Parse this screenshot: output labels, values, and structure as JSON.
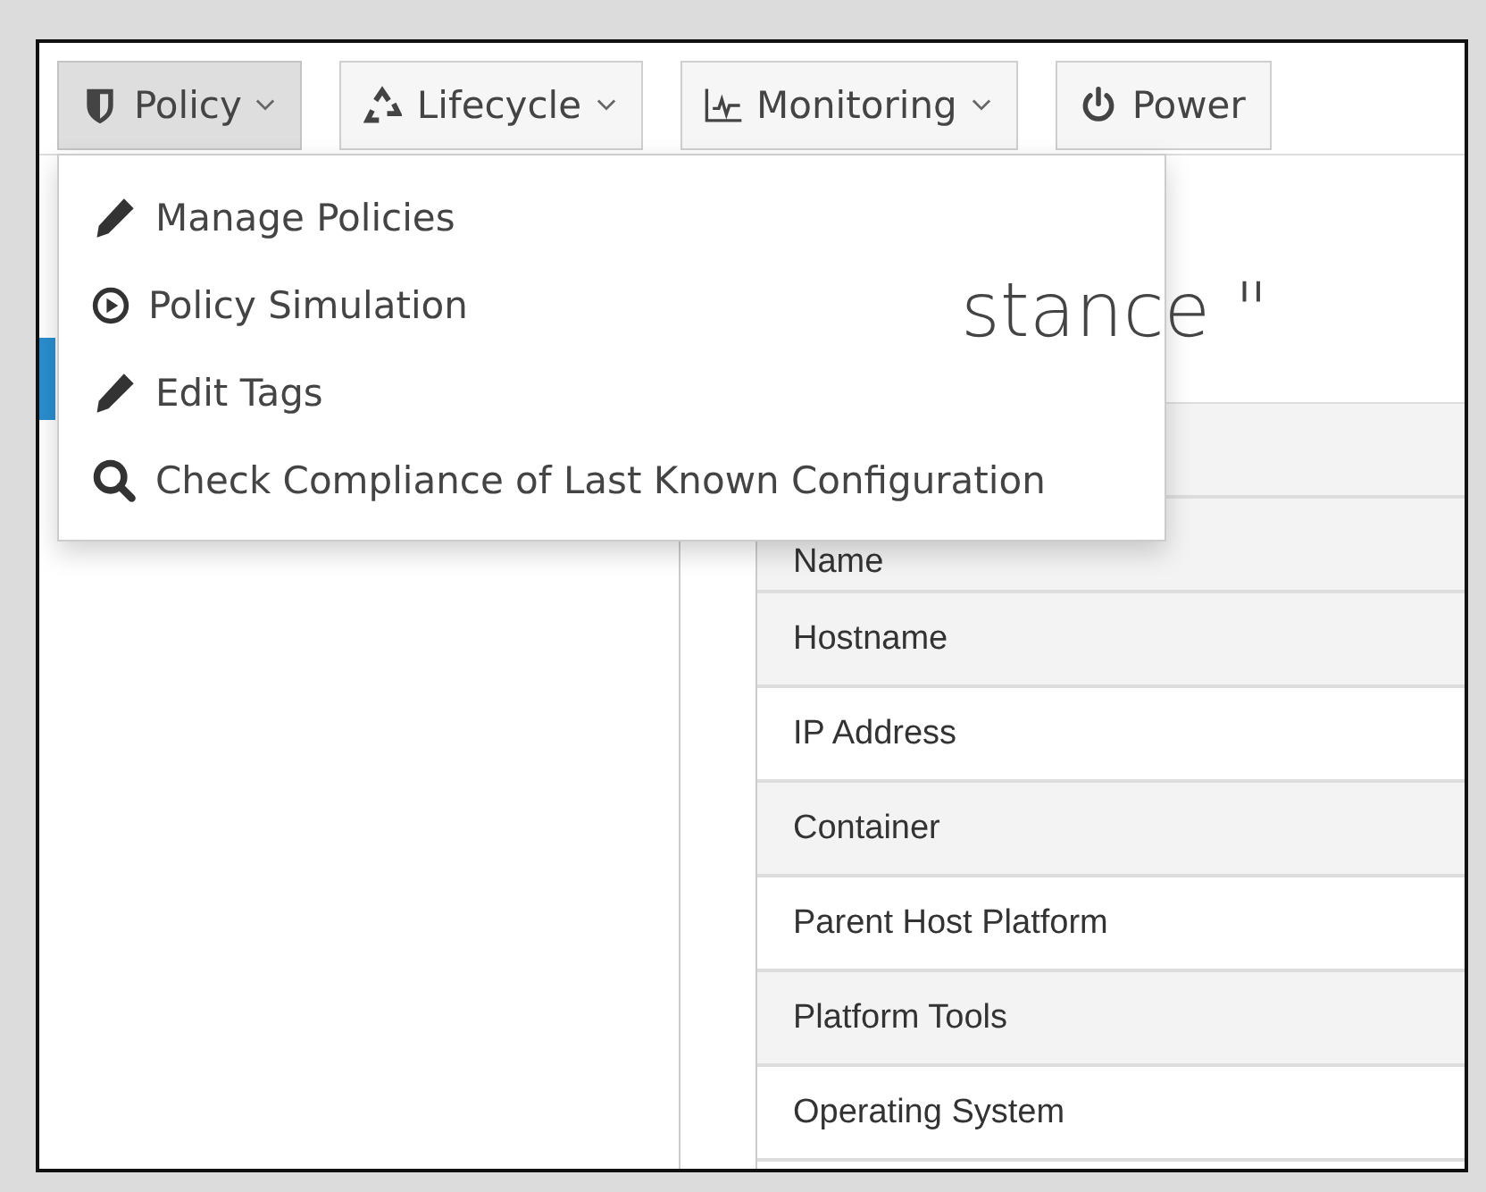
{
  "toolbar": [
    {
      "label": "Policy",
      "caret": true,
      "selected": true
    },
    {
      "label": "Lifecycle",
      "caret": true,
      "selected": false
    },
    {
      "label": "Monitoring",
      "caret": true,
      "selected": false
    },
    {
      "label": "Power",
      "caret": false,
      "selected": false
    }
  ],
  "menu": [
    {
      "label": "Manage Policies",
      "kind": "edit"
    },
    {
      "label": "Policy Simulation",
      "kind": "simulate"
    },
    {
      "label": "Edit Tags",
      "kind": "edit"
    },
    {
      "label": "Check Compliance of Last Known Configuration",
      "kind": "check"
    }
  ],
  "heading": "stance \"",
  "table": {
    "rows": [
      "Name",
      "Hostname",
      "IP Address",
      "Container",
      "Parent Host Platform",
      "Platform Tools",
      "Operating System"
    ]
  }
}
